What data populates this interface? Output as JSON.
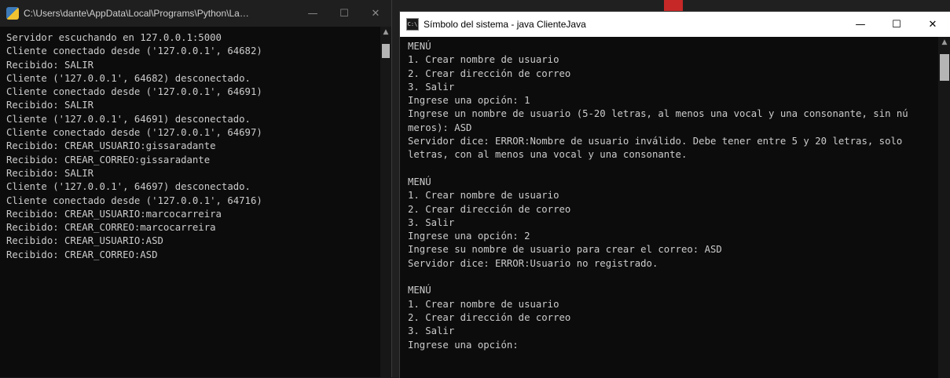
{
  "left_window": {
    "title": "C:\\Users\\dante\\AppData\\Local\\Programs\\Python\\Launcher\\py...",
    "lines": [
      "Servidor escuchando en 127.0.0.1:5000",
      "Cliente conectado desde ('127.0.0.1', 64682)",
      "Recibido: SALIR",
      "Cliente ('127.0.0.1', 64682) desconectado.",
      "Cliente conectado desde ('127.0.0.1', 64691)",
      "Recibido: SALIR",
      "Cliente ('127.0.0.1', 64691) desconectado.",
      "Cliente conectado desde ('127.0.0.1', 64697)",
      "Recibido: CREAR_USUARIO:gissaradante",
      "Recibido: CREAR_CORREO:gissaradante",
      "Recibido: SALIR",
      "Cliente ('127.0.0.1', 64697) desconectado.",
      "Cliente conectado desde ('127.0.0.1', 64716)",
      "Recibido: CREAR_USUARIO:marcocarreira",
      "Recibido: CREAR_CORREO:marcocarreira",
      "Recibido: CREAR_USUARIO:ASD",
      "Recibido: CREAR_CORREO:ASD"
    ]
  },
  "right_window": {
    "title": "Símbolo del sistema - java  ClienteJava",
    "icon_text": "C:\\",
    "lines": [
      "MENÚ",
      "1. Crear nombre de usuario",
      "2. Crear dirección de correo",
      "3. Salir",
      "Ingrese una opción: 1",
      "Ingrese un nombre de usuario (5-20 letras, al menos una vocal y una consonante, sin nú",
      "meros): ASD",
      "Servidor dice: ERROR:Nombre de usuario inválido. Debe tener entre 5 y 20 letras, solo",
      "letras, con al menos una vocal y una consonante.",
      "",
      "MENÚ",
      "1. Crear nombre de usuario",
      "2. Crear dirección de correo",
      "3. Salir",
      "Ingrese una opción: 2",
      "Ingrese su nombre de usuario para crear el correo: ASD",
      "Servidor dice: ERROR:Usuario no registrado.",
      "",
      "MENÚ",
      "1. Crear nombre de usuario",
      "2. Crear dirección de correo",
      "3. Salir",
      "Ingrese una opción:"
    ]
  },
  "controls": {
    "minimize": "—",
    "maximize": "☐",
    "close": "✕",
    "scroll_up": "▲"
  },
  "icons": {
    "left": "python-launcher-icon",
    "right": "cmd-icon"
  },
  "colors": {
    "console_bg": "#0c0c0c",
    "console_text": "#cccccc",
    "titlebar_dark": "#1f1f1f",
    "titlebar_light": "#ffffff"
  }
}
